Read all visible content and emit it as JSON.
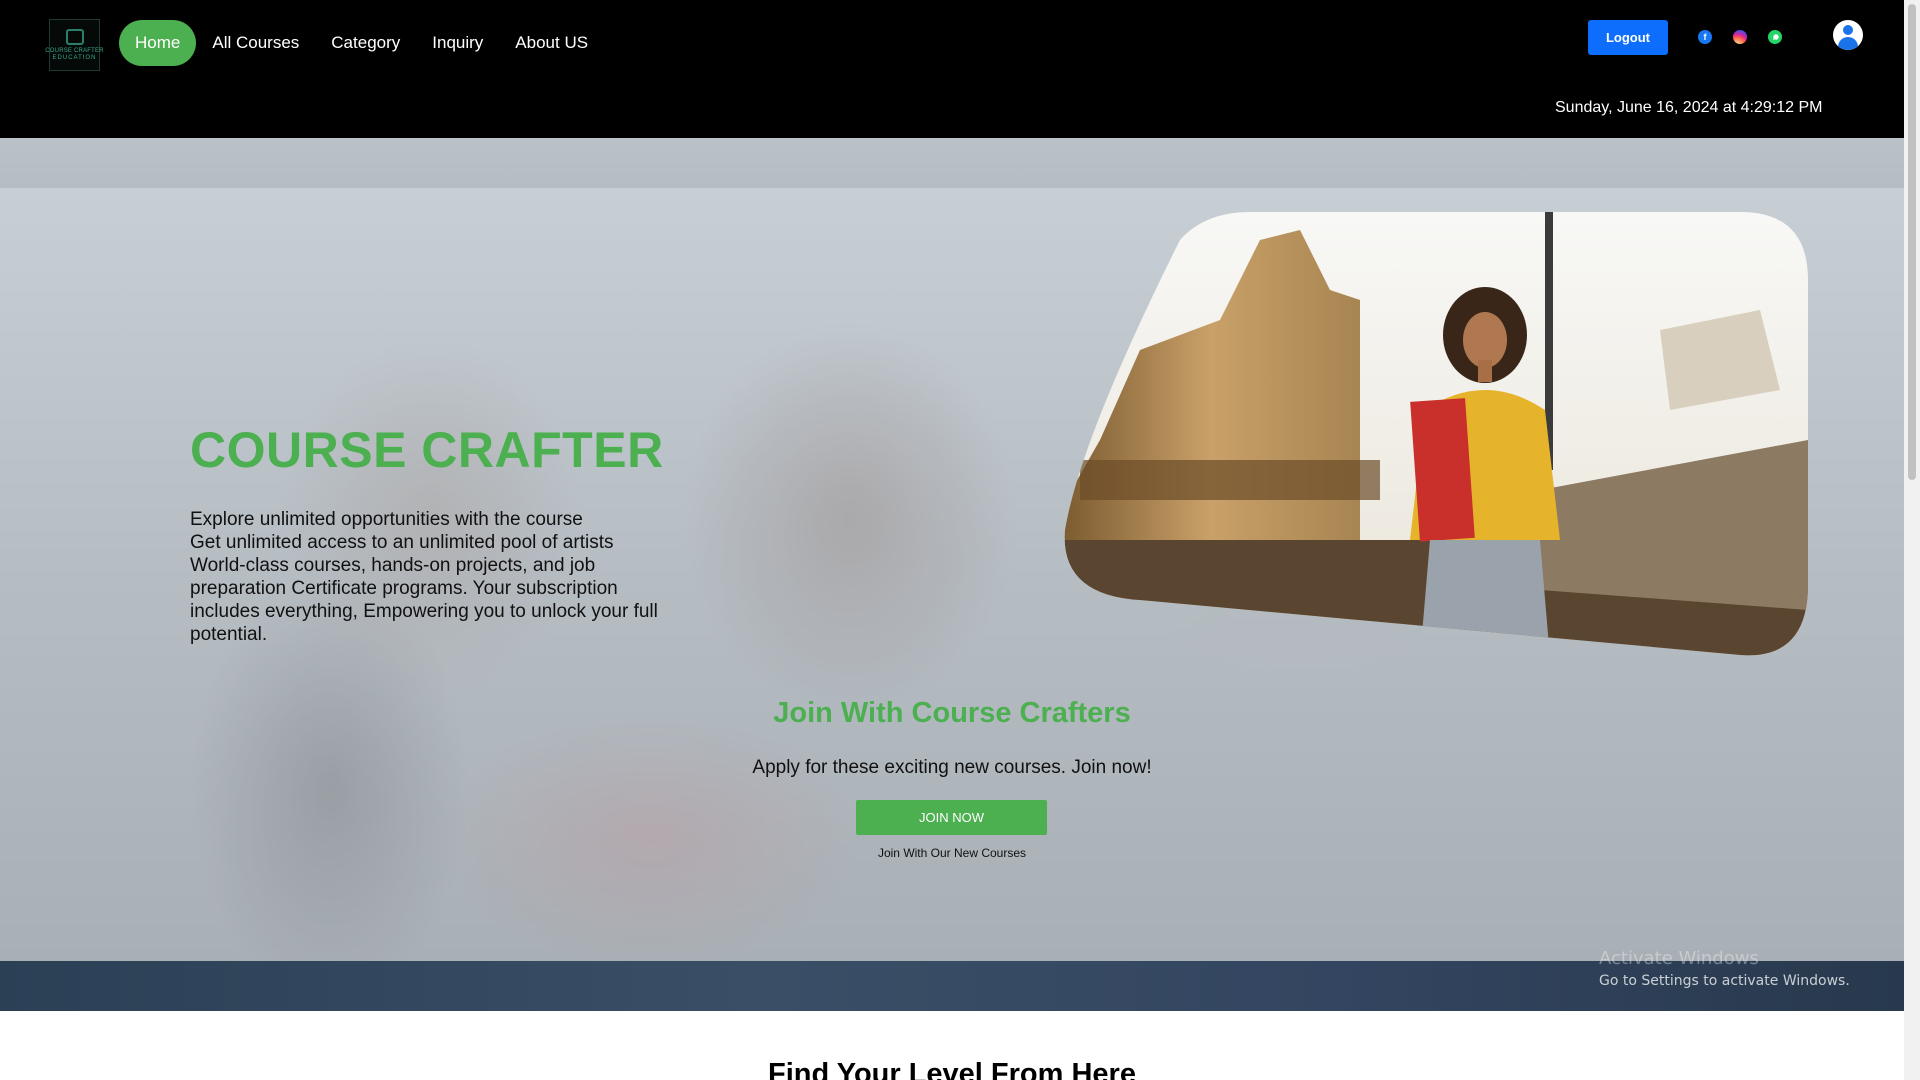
{
  "logo": {
    "line1": "COURSE CRAFTER",
    "line2": "EDUCATION"
  },
  "nav": {
    "items": [
      {
        "label": "Home",
        "active": true
      },
      {
        "label": "All Courses"
      },
      {
        "label": "Category"
      },
      {
        "label": "Inquiry"
      },
      {
        "label": "About US"
      }
    ]
  },
  "header": {
    "logout_label": "Logout",
    "social": [
      "facebook-icon",
      "instagram-icon",
      "whatsapp-icon"
    ],
    "datetime": "Sunday, June 16, 2024 at 4:29:12 PM"
  },
  "hero": {
    "title": "COURSE CRAFTER",
    "description": [
      "Explore unlimited opportunities with the course",
      "Get unlimited access to an unlimited pool of artists World-class courses, hands-on projects, and job preparation Certificate programs. Your subscription includes everything, Empowering you to unlock your full potential."
    ],
    "join_title": "Join With Course Crafters",
    "join_subtitle": "Apply for these exciting new courses. Join now!",
    "join_button": "JOIN NOW",
    "join_note": "Join With Our New Courses"
  },
  "watermark": {
    "line1": "Activate Windows",
    "line2": "Go to Settings to activate Windows."
  },
  "next_section": {
    "title": "Find Your Level From Here"
  },
  "colors": {
    "accent": "#4caf50",
    "logout": "#0d6efd",
    "nav_bg": "#000000"
  }
}
